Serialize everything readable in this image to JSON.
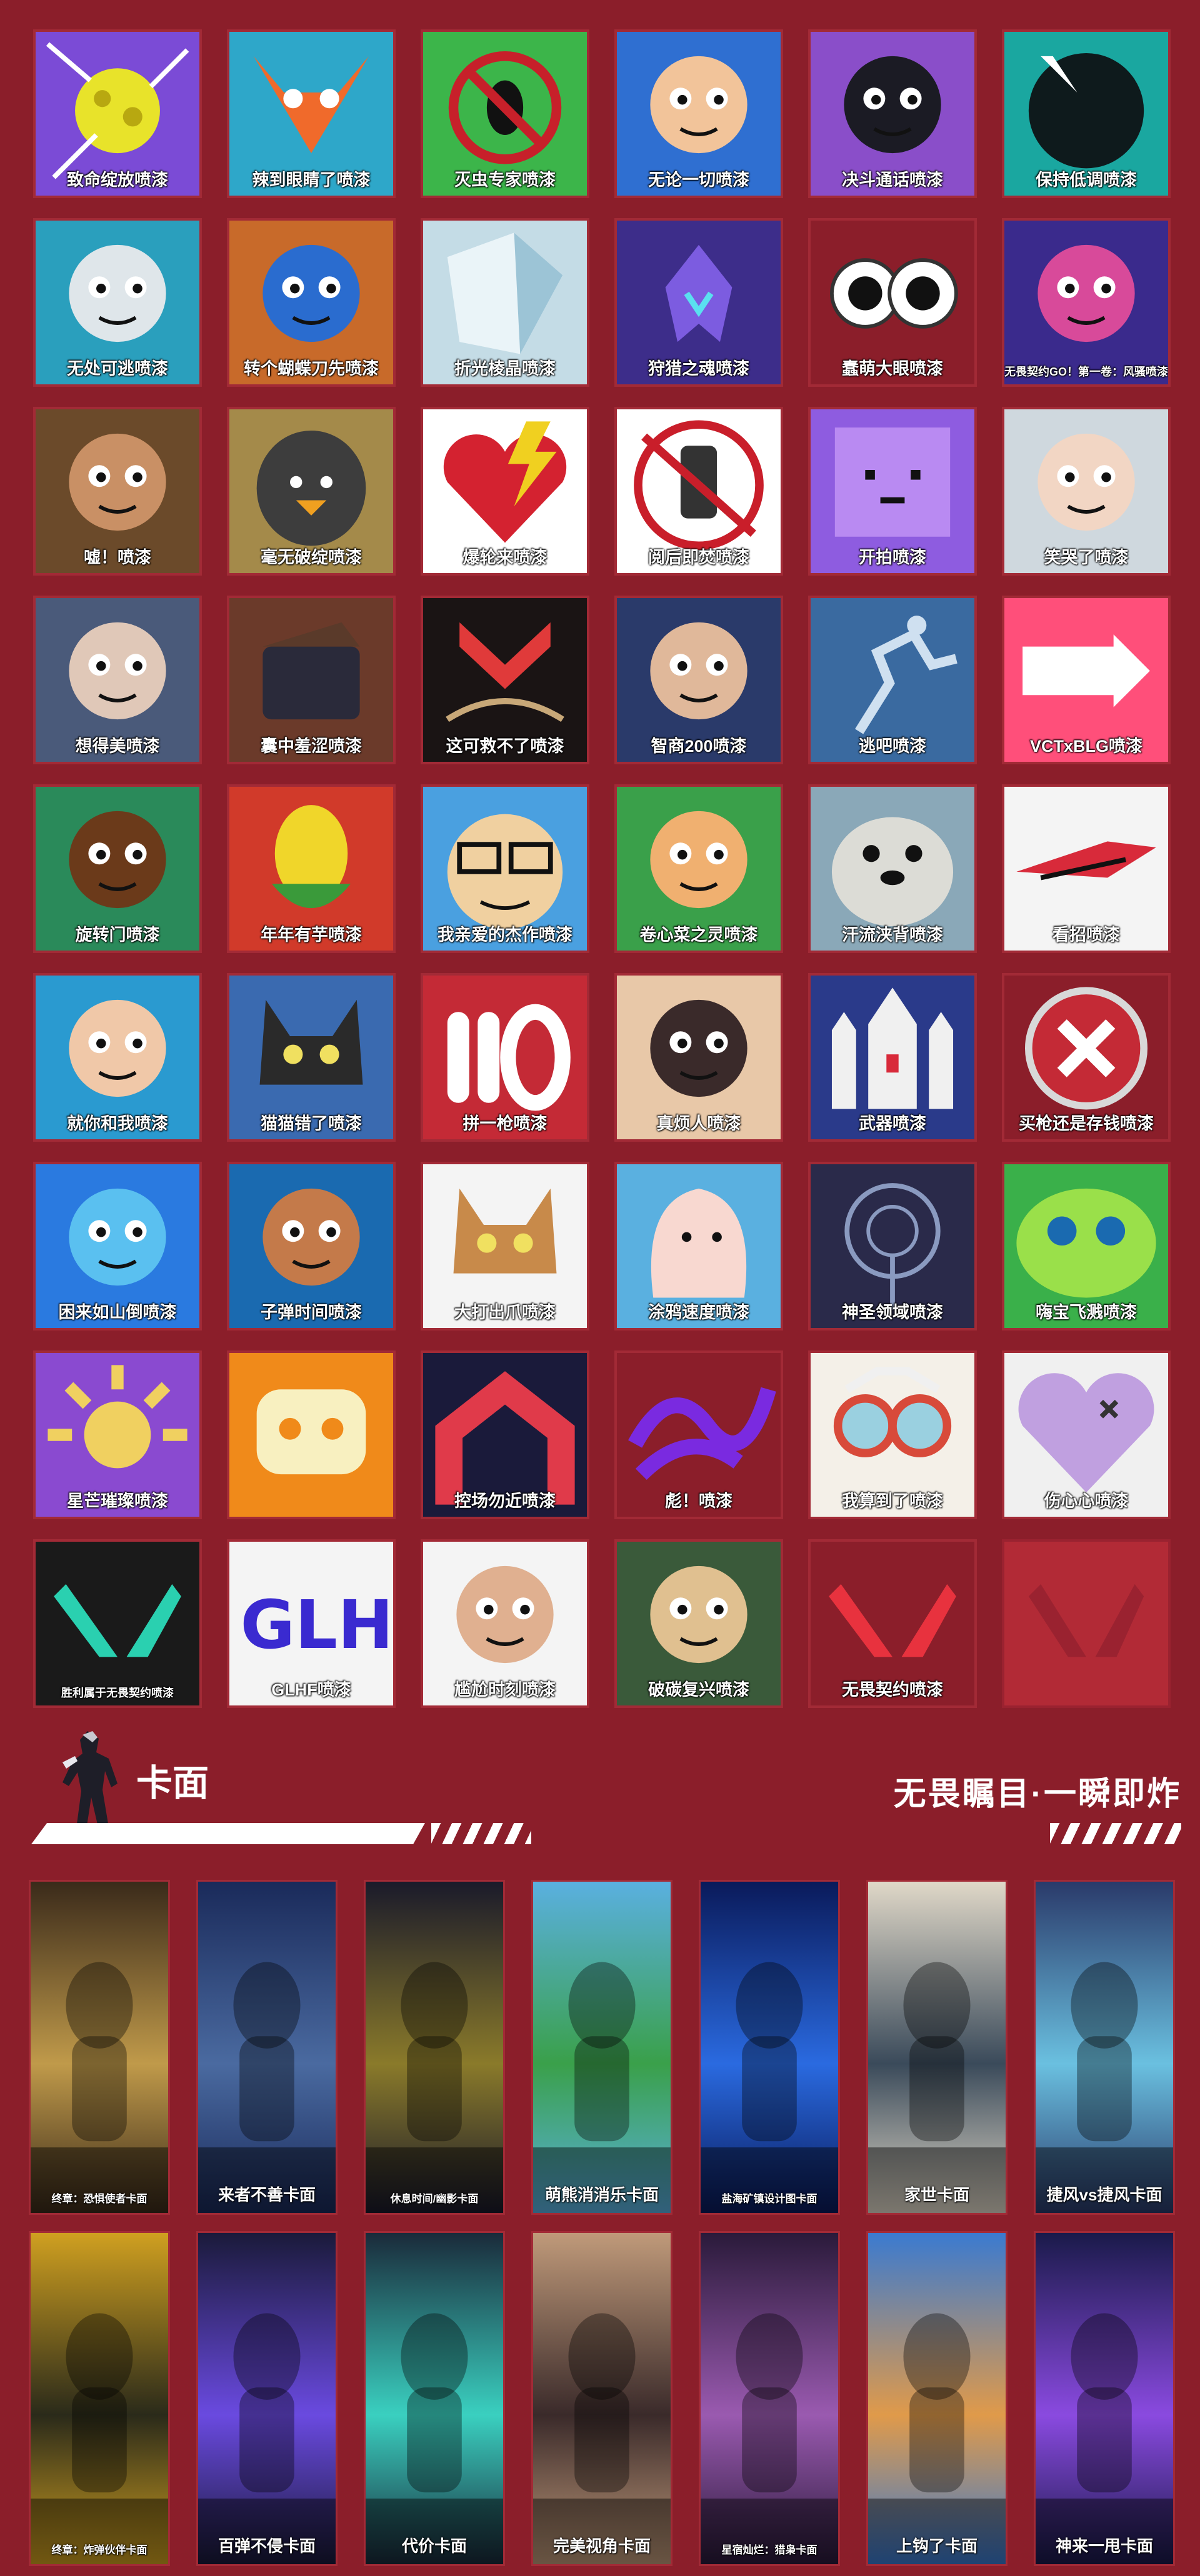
{
  "sprays": [
    {
      "label": "致命绽放喷漆",
      "bg": "#7b4bd6",
      "fg": "#e8e32a",
      "icon": "flower-orb"
    },
    {
      "label": "辣到眼睛了喷漆",
      "bg": "#2ea7c9",
      "fg": "#f06a2b",
      "icon": "fox-face"
    },
    {
      "label": "灭虫专家喷漆",
      "bg": "#3cb54a",
      "fg": "#c7202a",
      "icon": "no-bug"
    },
    {
      "label": "无论一切喷漆",
      "bg": "#2f6fd1",
      "fg": "#f2c49a",
      "icon": "bandage-face"
    },
    {
      "label": "决斗通话喷漆",
      "bg": "#8a4ec9",
      "fg": "#1b1b24",
      "icon": "agent-face"
    },
    {
      "label": "保持低调喷漆",
      "bg": "#1aa7a0",
      "fg": "#0e1a1c",
      "icon": "shadow-orb"
    },
    {
      "label": "无处可逃喷漆",
      "bg": "#2a9fbd",
      "fg": "#dfe6ea",
      "icon": "skull-face"
    },
    {
      "label": "转个蝴蝶刀先喷漆",
      "bg": "#c86a2a",
      "fg": "#2a6ccf",
      "icon": "agent-face"
    },
    {
      "label": "折光棱晶喷漆",
      "bg": "#c4dce6",
      "fg": "#eef6fa",
      "icon": "crystal"
    },
    {
      "label": "狩猎之魂喷漆",
      "bg": "#3d2d8a",
      "fg": "#7c5ce0",
      "icon": "spirit"
    },
    {
      "label": "蠢萌大眼喷漆",
      "bg": "#8b1e2a",
      "fg": "#ffffff",
      "icon": "googly-eyes"
    },
    {
      "label": "无畏契约GO！第一卷：风骚喷漆",
      "bg": "#3a2a8c",
      "fg": "#d84a9a",
      "icon": "agent-face",
      "small": true
    },
    {
      "label": "嘘！喷漆",
      "bg": "#6b4a2a",
      "fg": "#c99065",
      "icon": "agent-face"
    },
    {
      "label": "毫无破绽喷漆",
      "bg": "#a48a4a",
      "fg": "#3d3d3d",
      "icon": "duck"
    },
    {
      "label": "爆轮来喷漆",
      "bg": "#ffffff",
      "fg": "#d42230",
      "icon": "heart-bolt"
    },
    {
      "label": "阅后即焚喷漆",
      "bg": "#ffffff",
      "fg": "#c91e2a",
      "icon": "lamp"
    },
    {
      "label": "开拍喷漆",
      "bg": "#8e5ce0",
      "fg": "#b98af2",
      "icon": "pixel-face"
    },
    {
      "label": "笑哭了喷漆",
      "bg": "#cfd8de",
      "fg": "#f2d6c4",
      "icon": "agent-face"
    },
    {
      "label": "想得美喷漆",
      "bg": "#4a5a7a",
      "fg": "#e0c8b8",
      "icon": "agent-face"
    },
    {
      "label": "囊中羞涩喷漆",
      "bg": "#6b3a2a",
      "fg": "#2a2a3a",
      "icon": "wallet"
    },
    {
      "label": "这可救不了喷漆",
      "bg": "#1a1414",
      "fg": "#e03a3a",
      "icon": "academy"
    },
    {
      "label": "智商200喷漆",
      "bg": "#2a3a6a",
      "fg": "#e0b89a",
      "icon": "agent-face"
    },
    {
      "label": "逃吧喷漆",
      "bg": "#3a6aa0",
      "fg": "#cfe0f0",
      "icon": "runner"
    },
    {
      "label": "VCTxBLG喷漆",
      "bg": "#ff4f7a",
      "fg": "#ffffff",
      "icon": "logo"
    },
    {
      "label": "旋转门喷漆",
      "bg": "#2a8a5a",
      "fg": "#6b3a1a",
      "icon": "agent-face"
    },
    {
      "label": "年年有芋喷漆",
      "bg": "#d13a2a",
      "fg": "#f0d62a",
      "icon": "corn"
    },
    {
      "label": "我亲爱的杰作喷漆",
      "bg": "#4aa0e0",
      "fg": "#f0d0a0",
      "icon": "glasses-face"
    },
    {
      "label": "卷心菜之灵喷漆",
      "bg": "#3aa04a",
      "fg": "#f0b070",
      "icon": "agent-face"
    },
    {
      "label": "汗流浃背喷漆",
      "bg": "#8aa8b8",
      "fg": "#dcdcd6",
      "icon": "seal"
    },
    {
      "label": "看招喷漆",
      "bg": "#f4f4f4",
      "fg": "#d82a3a",
      "icon": "blade"
    },
    {
      "label": "就你和我喷漆",
      "bg": "#2a9ad0",
      "fg": "#f0c8a8",
      "icon": "agent-face"
    },
    {
      "label": "猫猫错了喷漆",
      "bg": "#3a6ab0",
      "fg": "#2a2a2a",
      "icon": "cat"
    },
    {
      "label": "拼一枪喷漆",
      "bg": "#c42a36",
      "fg": "#ffffff",
      "icon": "ammo"
    },
    {
      "label": "真烦人喷漆",
      "bg": "#e8c8a8",
      "fg": "#3a2a2a",
      "icon": "agent-face"
    },
    {
      "label": "武器喷漆",
      "bg": "#2a3a8a",
      "fg": "#f0f0f0",
      "icon": "rocket"
    },
    {
      "label": "买枪还是存钱喷漆",
      "bg": "#8b1e2a",
      "fg": "#ffffff",
      "icon": "cancel"
    },
    {
      "label": "困来如山倒喷漆",
      "bg": "#2a7ae0",
      "fg": "#5ac0f0",
      "icon": "agent-face"
    },
    {
      "label": "子弹时间喷漆",
      "bg": "#1a6ab0",
      "fg": "#c47a4a",
      "icon": "agent-face"
    },
    {
      "label": "大打出爪喷漆",
      "bg": "#f4f4f4",
      "fg": "#c88a4a",
      "icon": "cat"
    },
    {
      "label": "涂鸦速度喷漆",
      "bg": "#5ab0e0",
      "fg": "#f8d8d0",
      "icon": "blob"
    },
    {
      "label": "神圣领域喷漆",
      "bg": "#2a2a4a",
      "fg": "#8a9ac0",
      "icon": "orbit"
    },
    {
      "label": "嗨宝飞溅喷漆",
      "bg": "#3ab04a",
      "fg": "#9ae04a",
      "icon": "slime"
    },
    {
      "label": "星芒璀璨喷漆",
      "bg": "#8a4ad0",
      "fg": "#f0d060",
      "icon": "sun"
    },
    {
      "label": "",
      "bg": "#f08a1a",
      "fg": "#f8f0c0",
      "icon": "mask"
    },
    {
      "label": "控场勿近喷漆",
      "bg": "#1a1a3a",
      "fg": "#e03a4a",
      "icon": "chevron"
    },
    {
      "label": "彪！喷漆",
      "bg": "#8b1e2a",
      "fg": "#7a2ae0",
      "icon": "scribble"
    },
    {
      "label": "我算到了喷漆",
      "bg": "#f4f0e8",
      "fg": "#d84a3a",
      "icon": "goggles"
    },
    {
      "label": "伤心心喷漆",
      "bg": "#f0f0f0",
      "fg": "#c0a0e0",
      "icon": "heart"
    },
    {
      "label": "胜利属于无畏契约喷漆",
      "bg": "#1a1a1a",
      "fg": "#2ad0b0",
      "icon": "valorant",
      "small": true
    },
    {
      "label": "GLHF喷漆",
      "bg": "#f4f4f4",
      "fg": "#3a2ad0",
      "icon": "graffiti"
    },
    {
      "label": "尴尬时刻喷漆",
      "bg": "#f4f4f4",
      "fg": "#e0b090",
      "icon": "agent-face"
    },
    {
      "label": "破碳复兴喷漆",
      "bg": "#3a5a3a",
      "fg": "#e0c090",
      "icon": "agent-face"
    },
    {
      "label": "无畏契约喷漆",
      "bg": "#8b1e2a",
      "fg": "#e8323e",
      "icon": "valorant"
    },
    {
      "label": "",
      "bg": "#b22a36",
      "fg": "#9a2230",
      "icon": "valorant-faint"
    }
  ],
  "section": {
    "title": "卡面",
    "slogan": "无畏瞩目·一瞬即炸"
  },
  "cards": [
    {
      "label": "终章：恐惧使者卡面",
      "bg1": "#3a2a1a",
      "bg2": "#c09a4a",
      "small": true
    },
    {
      "label": "来者不善卡面",
      "bg1": "#1a2a5a",
      "bg2": "#4a6aa0"
    },
    {
      "label": "休息时间/幽影卡面",
      "bg1": "#1a1a2a",
      "bg2": "#8a7a2a",
      "small": true
    },
    {
      "label": "萌熊消消乐卡面",
      "bg1": "#5ab0e0",
      "bg2": "#3aa04a"
    },
    {
      "label": "盐海矿镇设计图卡面",
      "bg1": "#0a1a5a",
      "bg2": "#2a6ae0",
      "small": true
    },
    {
      "label": "家世卡面",
      "bg1": "#e0d8c8",
      "bg2": "#3a4a5a"
    },
    {
      "label": "捷风vs捷风卡面",
      "bg1": "#2a3a6a",
      "bg2": "#6ac0e0",
      "small": false
    },
    {
      "label": "终章：炸弹伙伴卡面",
      "bg1": "#d0a020",
      "bg2": "#2a2a1a",
      "small": true
    },
    {
      "label": "百弹不侵卡面",
      "bg1": "#1a1a3a",
      "bg2": "#6a4ae0"
    },
    {
      "label": "代价卡面",
      "bg1": "#1a2a3a",
      "bg2": "#3ad0c0"
    },
    {
      "label": "完美视角卡面",
      "bg1": "#c09a7a",
      "bg2": "#3a2a2a"
    },
    {
      "label": "星宿灿烂：猎枭卡面",
      "bg1": "#2a1a3a",
      "bg2": "#9a5ab0",
      "small": true
    },
    {
      "label": "上钩了卡面",
      "bg1": "#3a7ad0",
      "bg2": "#e09a4a"
    },
    {
      "label": "神来一甩卡面",
      "bg1": "#1a1a4a",
      "bg2": "#8a4ae0"
    }
  ]
}
